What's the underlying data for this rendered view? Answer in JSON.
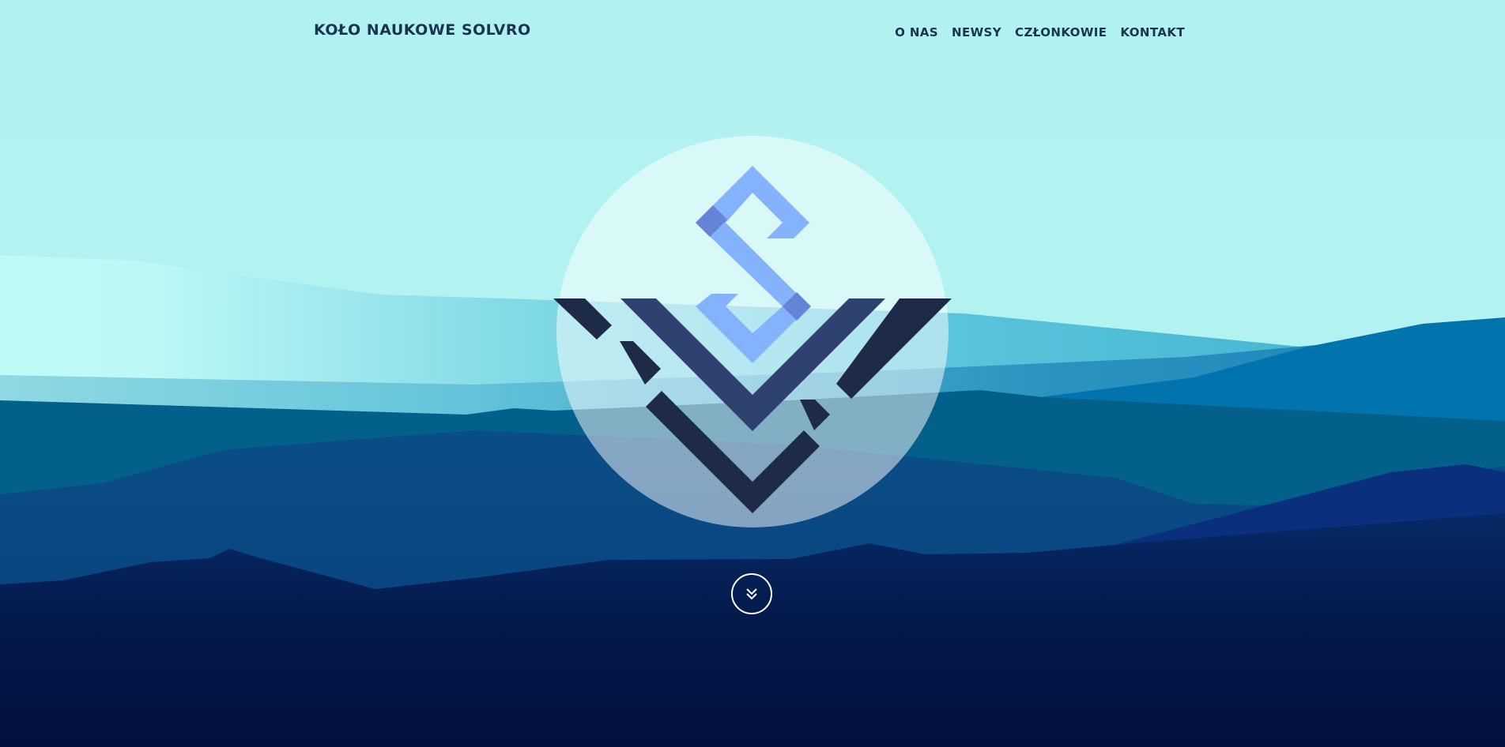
{
  "header": {
    "brand": "KOŁO NAUKOWE SOLVRO"
  },
  "nav": {
    "items": [
      {
        "label": "O NAS"
      },
      {
        "label": "NEWSY"
      },
      {
        "label": "CZŁONKOWIE"
      },
      {
        "label": "KONTAKT"
      }
    ]
  },
  "hero": {
    "logo_icon": "solvro-logo",
    "scroll_icon": "double-chevron-down-icon"
  },
  "colors": {
    "sky": "#b1f1ef",
    "nav_text": "#1a3350",
    "logo_light": "#85b2fd",
    "logo_mid": "#2f426f",
    "logo_dark": "#1d2a48",
    "deep_sea": "#03103e"
  }
}
